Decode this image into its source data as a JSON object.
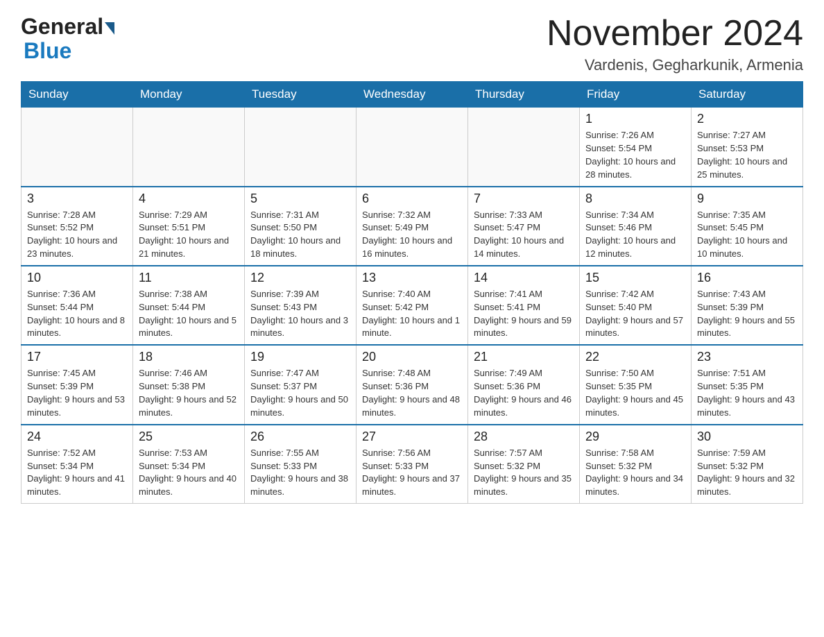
{
  "header": {
    "logo_general": "General",
    "logo_blue": "Blue",
    "month_title": "November 2024",
    "subtitle": "Vardenis, Gegharkunik, Armenia"
  },
  "weekdays": [
    "Sunday",
    "Monday",
    "Tuesday",
    "Wednesday",
    "Thursday",
    "Friday",
    "Saturday"
  ],
  "rows": [
    [
      {
        "day": "",
        "sunrise": "",
        "sunset": "",
        "daylight": ""
      },
      {
        "day": "",
        "sunrise": "",
        "sunset": "",
        "daylight": ""
      },
      {
        "day": "",
        "sunrise": "",
        "sunset": "",
        "daylight": ""
      },
      {
        "day": "",
        "sunrise": "",
        "sunset": "",
        "daylight": ""
      },
      {
        "day": "",
        "sunrise": "",
        "sunset": "",
        "daylight": ""
      },
      {
        "day": "1",
        "sunrise": "Sunrise: 7:26 AM",
        "sunset": "Sunset: 5:54 PM",
        "daylight": "Daylight: 10 hours and 28 minutes."
      },
      {
        "day": "2",
        "sunrise": "Sunrise: 7:27 AM",
        "sunset": "Sunset: 5:53 PM",
        "daylight": "Daylight: 10 hours and 25 minutes."
      }
    ],
    [
      {
        "day": "3",
        "sunrise": "Sunrise: 7:28 AM",
        "sunset": "Sunset: 5:52 PM",
        "daylight": "Daylight: 10 hours and 23 minutes."
      },
      {
        "day": "4",
        "sunrise": "Sunrise: 7:29 AM",
        "sunset": "Sunset: 5:51 PM",
        "daylight": "Daylight: 10 hours and 21 minutes."
      },
      {
        "day": "5",
        "sunrise": "Sunrise: 7:31 AM",
        "sunset": "Sunset: 5:50 PM",
        "daylight": "Daylight: 10 hours and 18 minutes."
      },
      {
        "day": "6",
        "sunrise": "Sunrise: 7:32 AM",
        "sunset": "Sunset: 5:49 PM",
        "daylight": "Daylight: 10 hours and 16 minutes."
      },
      {
        "day": "7",
        "sunrise": "Sunrise: 7:33 AM",
        "sunset": "Sunset: 5:47 PM",
        "daylight": "Daylight: 10 hours and 14 minutes."
      },
      {
        "day": "8",
        "sunrise": "Sunrise: 7:34 AM",
        "sunset": "Sunset: 5:46 PM",
        "daylight": "Daylight: 10 hours and 12 minutes."
      },
      {
        "day": "9",
        "sunrise": "Sunrise: 7:35 AM",
        "sunset": "Sunset: 5:45 PM",
        "daylight": "Daylight: 10 hours and 10 minutes."
      }
    ],
    [
      {
        "day": "10",
        "sunrise": "Sunrise: 7:36 AM",
        "sunset": "Sunset: 5:44 PM",
        "daylight": "Daylight: 10 hours and 8 minutes."
      },
      {
        "day": "11",
        "sunrise": "Sunrise: 7:38 AM",
        "sunset": "Sunset: 5:44 PM",
        "daylight": "Daylight: 10 hours and 5 minutes."
      },
      {
        "day": "12",
        "sunrise": "Sunrise: 7:39 AM",
        "sunset": "Sunset: 5:43 PM",
        "daylight": "Daylight: 10 hours and 3 minutes."
      },
      {
        "day": "13",
        "sunrise": "Sunrise: 7:40 AM",
        "sunset": "Sunset: 5:42 PM",
        "daylight": "Daylight: 10 hours and 1 minute."
      },
      {
        "day": "14",
        "sunrise": "Sunrise: 7:41 AM",
        "sunset": "Sunset: 5:41 PM",
        "daylight": "Daylight: 9 hours and 59 minutes."
      },
      {
        "day": "15",
        "sunrise": "Sunrise: 7:42 AM",
        "sunset": "Sunset: 5:40 PM",
        "daylight": "Daylight: 9 hours and 57 minutes."
      },
      {
        "day": "16",
        "sunrise": "Sunrise: 7:43 AM",
        "sunset": "Sunset: 5:39 PM",
        "daylight": "Daylight: 9 hours and 55 minutes."
      }
    ],
    [
      {
        "day": "17",
        "sunrise": "Sunrise: 7:45 AM",
        "sunset": "Sunset: 5:39 PM",
        "daylight": "Daylight: 9 hours and 53 minutes."
      },
      {
        "day": "18",
        "sunrise": "Sunrise: 7:46 AM",
        "sunset": "Sunset: 5:38 PM",
        "daylight": "Daylight: 9 hours and 52 minutes."
      },
      {
        "day": "19",
        "sunrise": "Sunrise: 7:47 AM",
        "sunset": "Sunset: 5:37 PM",
        "daylight": "Daylight: 9 hours and 50 minutes."
      },
      {
        "day": "20",
        "sunrise": "Sunrise: 7:48 AM",
        "sunset": "Sunset: 5:36 PM",
        "daylight": "Daylight: 9 hours and 48 minutes."
      },
      {
        "day": "21",
        "sunrise": "Sunrise: 7:49 AM",
        "sunset": "Sunset: 5:36 PM",
        "daylight": "Daylight: 9 hours and 46 minutes."
      },
      {
        "day": "22",
        "sunrise": "Sunrise: 7:50 AM",
        "sunset": "Sunset: 5:35 PM",
        "daylight": "Daylight: 9 hours and 45 minutes."
      },
      {
        "day": "23",
        "sunrise": "Sunrise: 7:51 AM",
        "sunset": "Sunset: 5:35 PM",
        "daylight": "Daylight: 9 hours and 43 minutes."
      }
    ],
    [
      {
        "day": "24",
        "sunrise": "Sunrise: 7:52 AM",
        "sunset": "Sunset: 5:34 PM",
        "daylight": "Daylight: 9 hours and 41 minutes."
      },
      {
        "day": "25",
        "sunrise": "Sunrise: 7:53 AM",
        "sunset": "Sunset: 5:34 PM",
        "daylight": "Daylight: 9 hours and 40 minutes."
      },
      {
        "day": "26",
        "sunrise": "Sunrise: 7:55 AM",
        "sunset": "Sunset: 5:33 PM",
        "daylight": "Daylight: 9 hours and 38 minutes."
      },
      {
        "day": "27",
        "sunrise": "Sunrise: 7:56 AM",
        "sunset": "Sunset: 5:33 PM",
        "daylight": "Daylight: 9 hours and 37 minutes."
      },
      {
        "day": "28",
        "sunrise": "Sunrise: 7:57 AM",
        "sunset": "Sunset: 5:32 PM",
        "daylight": "Daylight: 9 hours and 35 minutes."
      },
      {
        "day": "29",
        "sunrise": "Sunrise: 7:58 AM",
        "sunset": "Sunset: 5:32 PM",
        "daylight": "Daylight: 9 hours and 34 minutes."
      },
      {
        "day": "30",
        "sunrise": "Sunrise: 7:59 AM",
        "sunset": "Sunset: 5:32 PM",
        "daylight": "Daylight: 9 hours and 32 minutes."
      }
    ]
  ]
}
